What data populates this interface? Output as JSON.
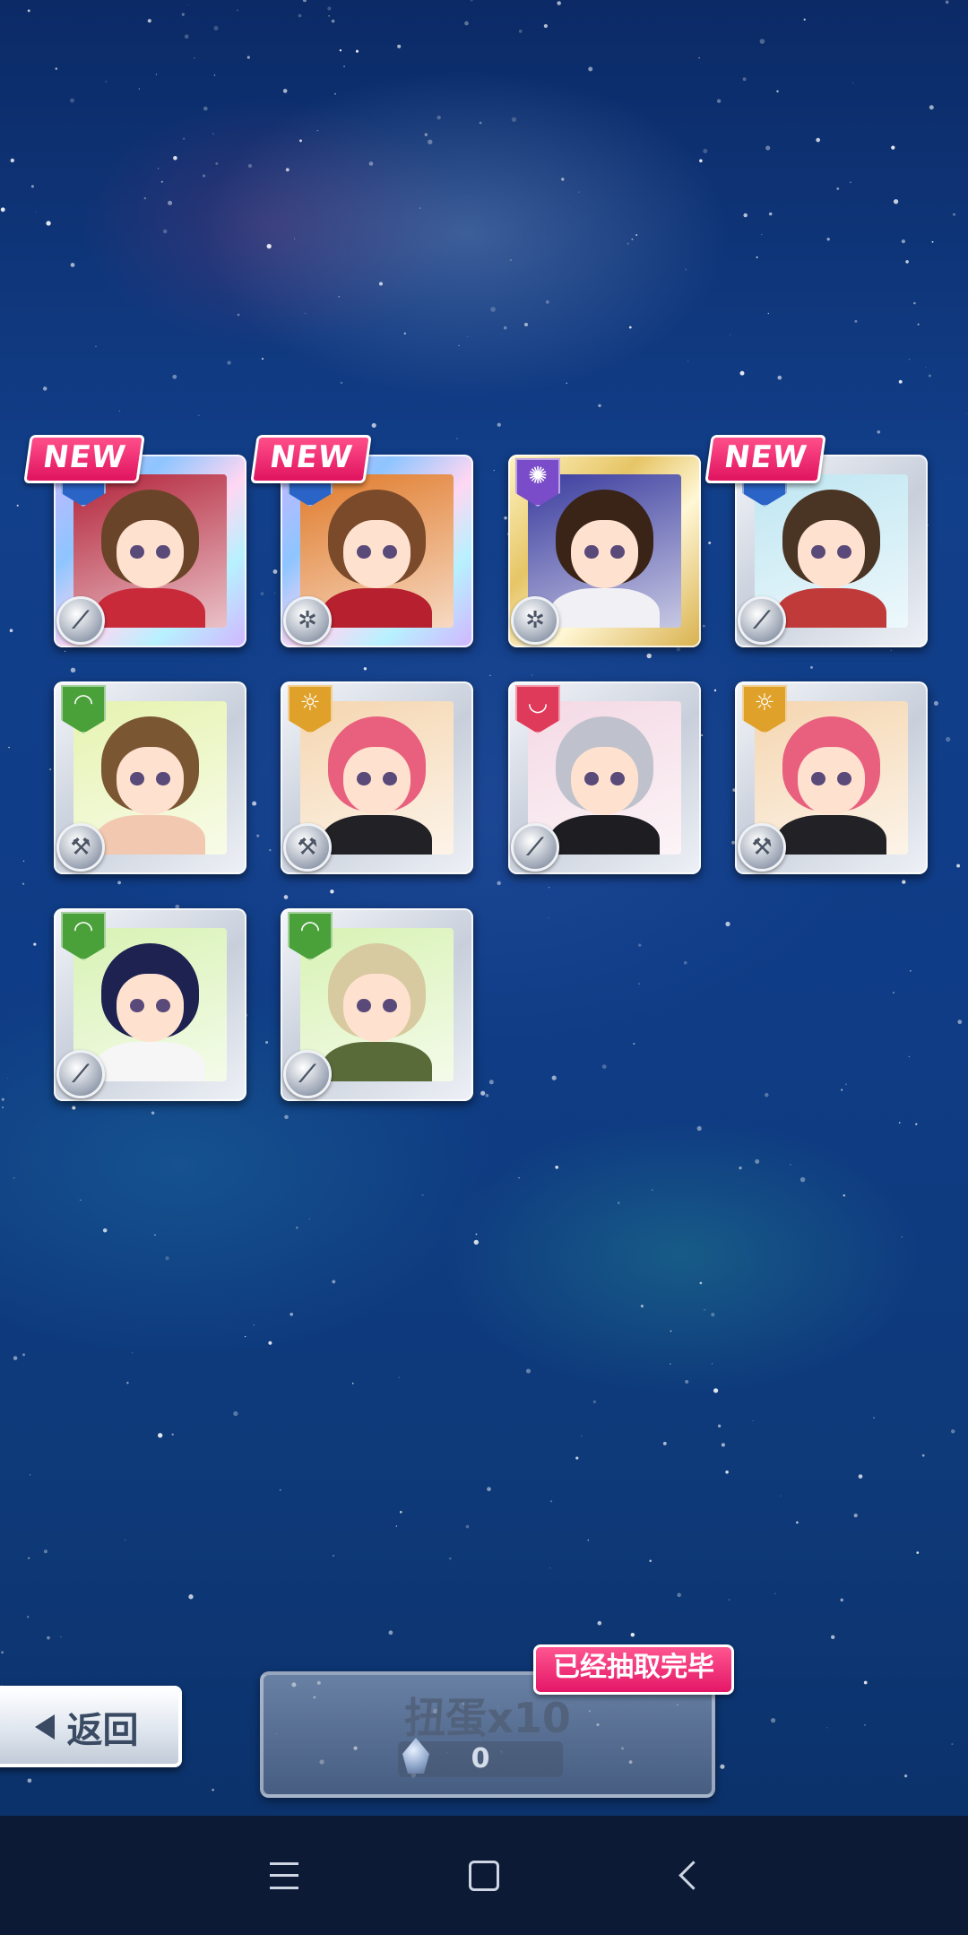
{
  "cards": [
    {
      "frame": "rainbow",
      "new": true,
      "attr": {
        "color": "#2a64c7",
        "icon": "crown-icon",
        "glyph": "♛"
      },
      "role": {
        "icon": "wrench-icon",
        "glyph": "⟋"
      },
      "portrait": {
        "bg": "#b3243a",
        "hair": "#6a4428",
        "outfit": "#c82a3a"
      }
    },
    {
      "frame": "rainbow",
      "new": true,
      "attr": {
        "color": "#2a64c7",
        "icon": "crown-icon",
        "glyph": "♛"
      },
      "role": {
        "icon": "gear-icon",
        "glyph": "✲"
      },
      "portrait": {
        "bg": "#e07a2a",
        "hair": "#7a4a2a",
        "outfit": "#b7202e"
      }
    },
    {
      "frame": "gold",
      "new": false,
      "attr": {
        "color": "#7b4cc9",
        "icon": "cosmic-icon",
        "glyph": "✺"
      },
      "role": {
        "icon": "gear-icon",
        "glyph": "✲"
      },
      "portrait": {
        "bg": "#3a3c9e",
        "hair": "#3a2418",
        "outfit": "#f0f0f5"
      }
    },
    {
      "frame": "silver",
      "new": true,
      "attr": {
        "color": "#2a64c7",
        "icon": "crown-icon",
        "glyph": "♛"
      },
      "role": {
        "icon": "wrench-icon",
        "glyph": "⟋"
      },
      "portrait": {
        "bg": "#bfe6f2",
        "hair": "#4a3424",
        "outfit": "#c03a3a"
      }
    },
    {
      "frame": "silver",
      "new": false,
      "attr": {
        "color": "#4aa13a",
        "icon": "nature-icon",
        "glyph": "◠"
      },
      "role": {
        "icon": "hammer-icon",
        "glyph": "⚒"
      },
      "portrait": {
        "bg": "#e6f3b0",
        "hair": "#7b5633",
        "outfit": "#f2c9b0"
      }
    },
    {
      "frame": "silver",
      "new": false,
      "attr": {
        "color": "#e0a12a",
        "icon": "sun-icon",
        "glyph": "☼"
      },
      "role": {
        "icon": "hammer-icon",
        "glyph": "⚒"
      },
      "portrait": {
        "bg": "#f5d6b0",
        "hair": "#e8607e",
        "outfit": "#222226"
      }
    },
    {
      "frame": "silver",
      "new": false,
      "attr": {
        "color": "#e03a5a",
        "icon": "moon-icon",
        "glyph": "◡"
      },
      "role": {
        "icon": "wrench-icon",
        "glyph": "⟋"
      },
      "portrait": {
        "bg": "#f4d9e4",
        "hair": "#bfc2cc",
        "outfit": "#1e1e22"
      }
    },
    {
      "frame": "silver",
      "new": false,
      "attr": {
        "color": "#e0a12a",
        "icon": "sun-icon",
        "glyph": "☼"
      },
      "role": {
        "icon": "hammer-icon",
        "glyph": "⚒"
      },
      "portrait": {
        "bg": "#f5d6b0",
        "hair": "#e8607e",
        "outfit": "#222226"
      }
    },
    {
      "frame": "silver",
      "new": false,
      "attr": {
        "color": "#4aa13a",
        "icon": "nature-icon",
        "glyph": "◠"
      },
      "role": {
        "icon": "wrench-icon",
        "glyph": "⟋"
      },
      "portrait": {
        "bg": "#d8f2b4",
        "hair": "#1e2250",
        "outfit": "#f6f6f6"
      }
    },
    {
      "frame": "silver",
      "new": false,
      "attr": {
        "color": "#4aa13a",
        "icon": "nature-icon",
        "glyph": "◠"
      },
      "role": {
        "icon": "wrench-icon",
        "glyph": "⟋"
      },
      "portrait": {
        "bg": "#d8f2b4",
        "hair": "#d8caa0",
        "outfit": "#5a6b3a"
      }
    }
  ],
  "new_label": "NEW",
  "back_button": {
    "label": "返回"
  },
  "gacha_button": {
    "label": "扭蛋x10",
    "cost": "0",
    "status_banner": "已经抽取完毕"
  },
  "nav": {
    "menu_icon": "menu-icon",
    "home_icon": "home-icon",
    "back_icon": "back-icon"
  }
}
